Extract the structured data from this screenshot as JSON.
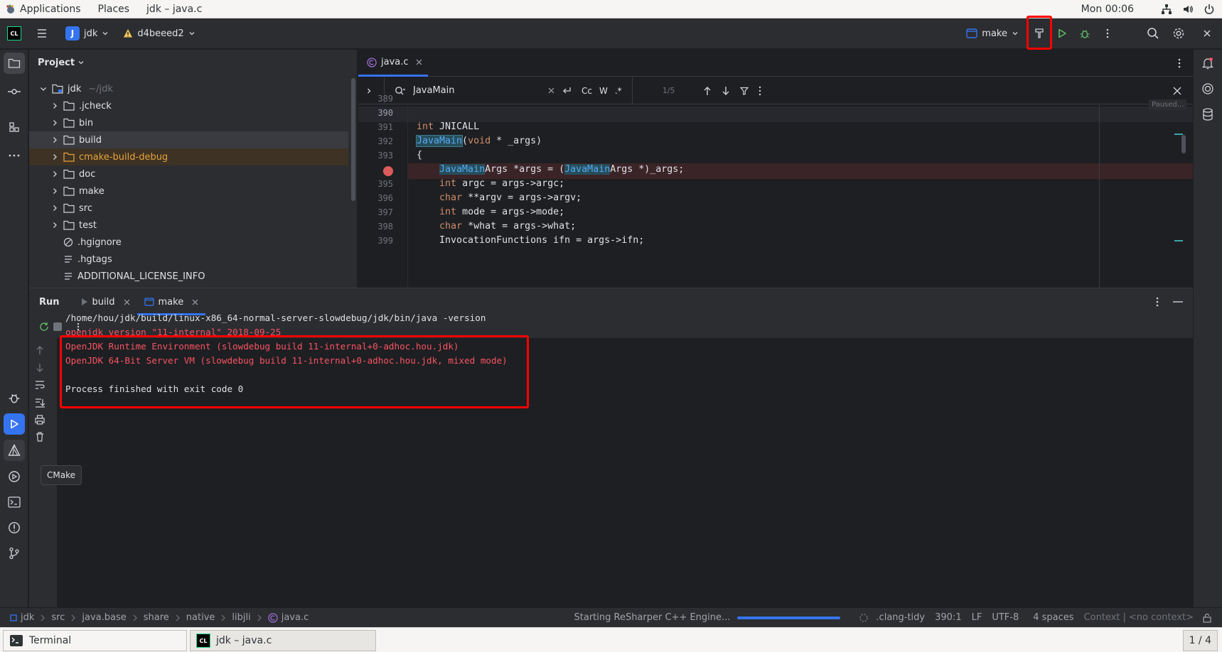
{
  "gnome": {
    "applications": "Applications",
    "places": "Places",
    "window_title": "jdk – java.c",
    "clock": "Mon 00:06"
  },
  "toolbar": {
    "project_letter": "J",
    "project_name": "jdk",
    "branch": "d4beeed2",
    "run_config": "make"
  },
  "project": {
    "title": "Project",
    "root": {
      "name": "jdk",
      "path": "~/jdk"
    },
    "items": [
      {
        "name": ".jcheck",
        "kind": "folder"
      },
      {
        "name": "bin",
        "kind": "folder"
      },
      {
        "name": "build",
        "kind": "folder"
      },
      {
        "name": "cmake-build-debug",
        "kind": "folder"
      },
      {
        "name": "doc",
        "kind": "folder"
      },
      {
        "name": "make",
        "kind": "folder"
      },
      {
        "name": "src",
        "kind": "folder"
      },
      {
        "name": "test",
        "kind": "folder"
      },
      {
        "name": ".hgignore",
        "kind": "file"
      },
      {
        "name": ".hgtags",
        "kind": "file"
      },
      {
        "name": "ADDITIONAL_LICENSE_INFO",
        "kind": "file"
      }
    ]
  },
  "editor": {
    "tab": "java.c",
    "search": {
      "query": "JavaMain",
      "options": [
        "Cc",
        "W",
        ".*"
      ],
      "count": "1/5"
    },
    "paused": "Paused...",
    "lines": [
      {
        "n": "389",
        "text": ""
      },
      {
        "n": "390",
        "text": ""
      },
      {
        "n": "391",
        "text": "int JNICALL"
      },
      {
        "n": "392",
        "text": "JavaMain(void * _args)"
      },
      {
        "n": "393",
        "text": "{"
      },
      {
        "n": "",
        "text": "    JavaMainArgs *args = (JavaMainArgs *)_args;"
      },
      {
        "n": "395",
        "text": "    int argc = args->argc;"
      },
      {
        "n": "396",
        "text": "    char **argv = args->argv;"
      },
      {
        "n": "397",
        "text": "    int mode = args->mode;"
      },
      {
        "n": "398",
        "text": "    char *what = args->what;"
      },
      {
        "n": "399",
        "text": "    InvocationFunctions ifn = args->ifn;"
      }
    ]
  },
  "run": {
    "title": "Run",
    "tabs": [
      {
        "label": "build"
      },
      {
        "label": "make"
      }
    ],
    "output": [
      "/home/hou/jdk/build/linux-x86_64-normal-server-slowdebug/jdk/bin/java -version",
      "openjdk version \"11-internal\" 2018-09-25",
      "OpenJDK Runtime Environment (slowdebug build 11-internal+0-adhoc.hou.jdk)",
      "OpenJDK 64-Bit Server VM (slowdebug build 11-internal+0-adhoc.hou.jdk, mixed mode)",
      "Process finished with exit code 0"
    ],
    "tooltip": "CMake"
  },
  "status": {
    "breadcrumbs": [
      "jdk",
      "src",
      "java.base",
      "share",
      "native",
      "libjli",
      "java.c"
    ],
    "progress_text": "Starting ReSharper C++ Engine...",
    "progress": 1.0,
    "clang_tidy": ".clang-tidy",
    "position": "390:1",
    "line_sep": "LF",
    "encoding": "UTF-8",
    "indent": "4 spaces",
    "context_label": "Context",
    "context_value": "<no context>"
  },
  "taskbar": {
    "terminal": "Terminal",
    "ide": "jdk – java.c",
    "workspace": "1 / 4"
  },
  "colors": {
    "accent": "#3574f0",
    "error": "#f75464",
    "run_green": "#5fb865",
    "highlight_box": "#ff0000"
  }
}
